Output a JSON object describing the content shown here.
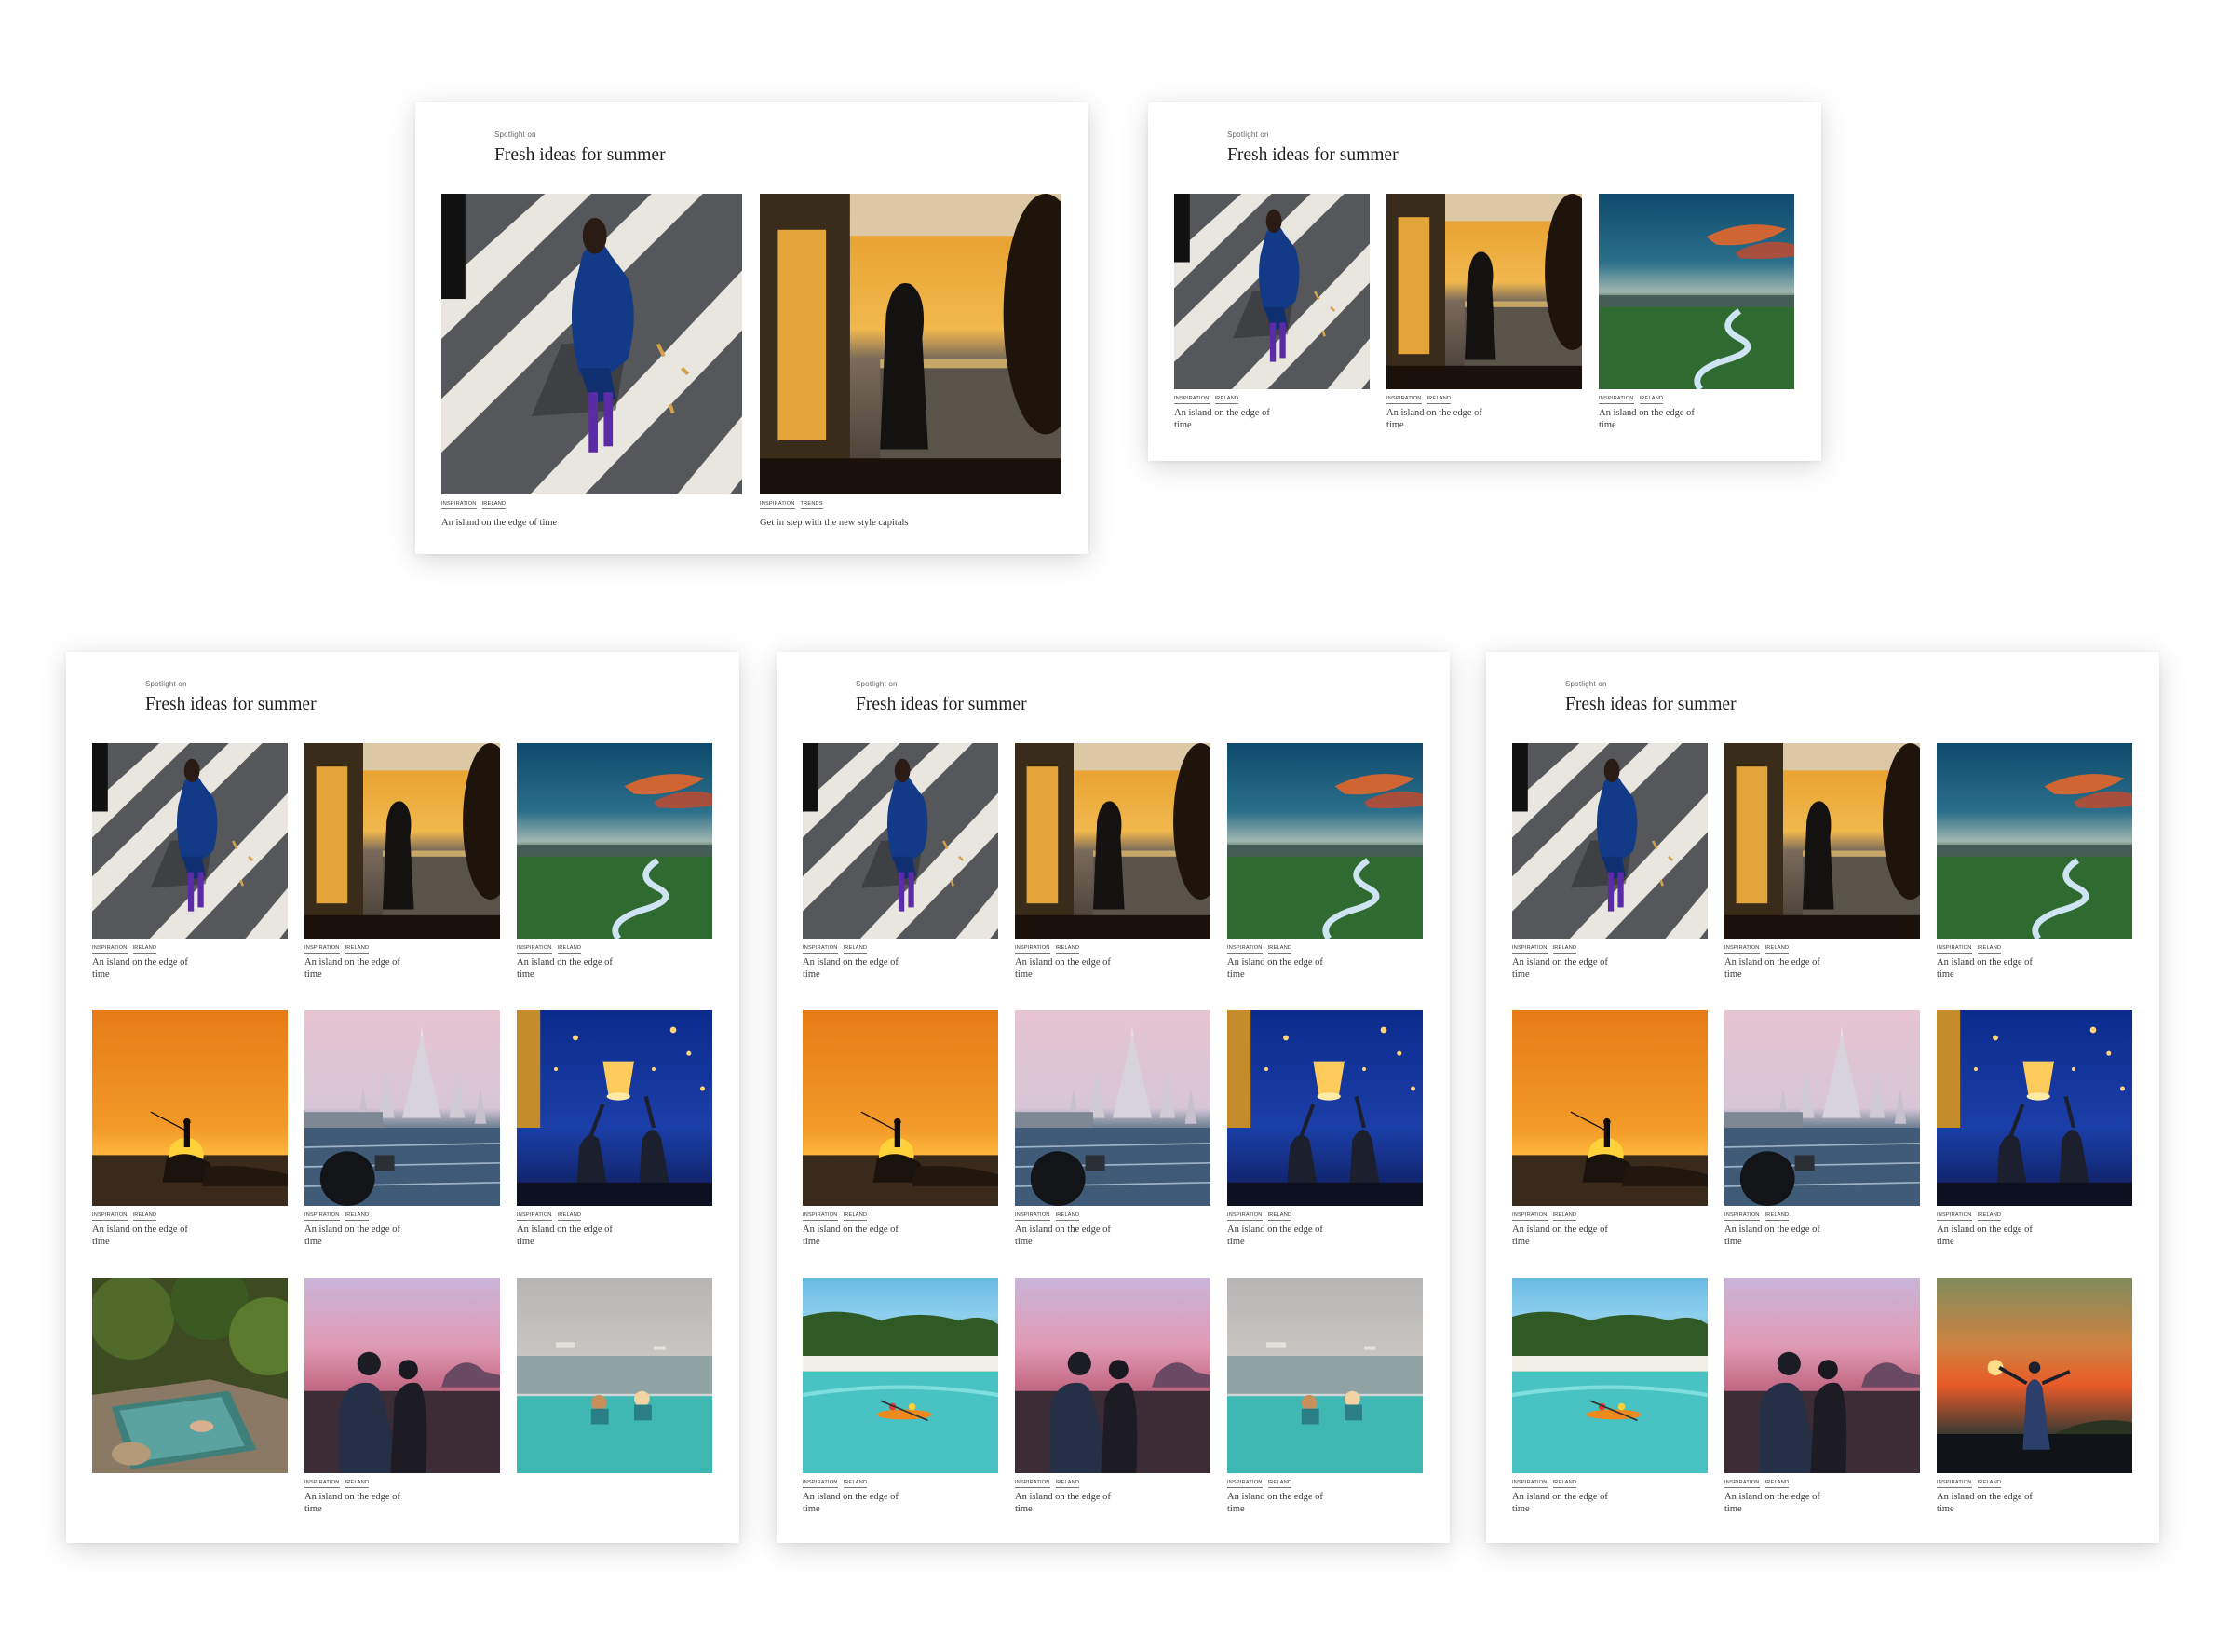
{
  "section": {
    "kicker": "Spotlight on",
    "title": "Fresh ideas for summer"
  },
  "boards": [
    {
      "cols": 2,
      "items": [
        {
          "image": "woman-crosswalk",
          "tags": [
            "INSPIRATION",
            "IRELAND"
          ],
          "caption": "An island on the edge of time"
        },
        {
          "image": "ferry-sunset",
          "tags": [
            "INSPIRATION",
            "TRENDS"
          ],
          "caption": "Get in step with the new style capitals"
        }
      ]
    },
    {
      "cols": 3,
      "items": [
        {
          "image": "woman-crosswalk",
          "tags": [
            "INSPIRATION",
            "IRELAND"
          ],
          "caption": "An island on the edge of time"
        },
        {
          "image": "ferry-sunset",
          "tags": [
            "INSPIRATION",
            "IRELAND"
          ],
          "caption": "An island on the edge of time"
        },
        {
          "image": "river-valley-sunset",
          "tags": [
            "INSPIRATION",
            "IRELAND"
          ],
          "caption": "An island on the edge of time"
        }
      ]
    },
    {
      "cols": 3,
      "items": [
        {
          "image": "woman-crosswalk",
          "tags": [
            "INSPIRATION",
            "IRELAND"
          ],
          "caption": "An island on the edge of time"
        },
        {
          "image": "ferry-sunset",
          "tags": [
            "INSPIRATION",
            "IRELAND"
          ],
          "caption": "An island on the edge of time"
        },
        {
          "image": "river-valley-sunset",
          "tags": [
            "INSPIRATION",
            "IRELAND"
          ],
          "caption": "An island on the edge of time"
        },
        {
          "image": "fisherman-sunset",
          "tags": [
            "INSPIRATION",
            "IRELAND"
          ],
          "caption": "An island on the edge of time"
        },
        {
          "image": "temple-river",
          "tags": [
            "INSPIRATION",
            "IRELAND"
          ],
          "caption": "An island on the edge of time"
        },
        {
          "image": "sky-lanterns",
          "tags": [
            "INSPIRATION",
            "IRELAND"
          ],
          "caption": "An island on the edge of time"
        },
        {
          "image": "jungle-pool",
          "tags": [],
          "caption": ""
        },
        {
          "image": "couple-beach-dusk",
          "tags": [
            "INSPIRATION",
            "IRELAND"
          ],
          "caption": "An island on the edge of time"
        },
        {
          "image": "infinity-pool",
          "tags": [],
          "caption": ""
        }
      ]
    },
    {
      "cols": 3,
      "items": [
        {
          "image": "woman-crosswalk",
          "tags": [
            "INSPIRATION",
            "IRELAND"
          ],
          "caption": "An island on the edge of time"
        },
        {
          "image": "ferry-sunset",
          "tags": [
            "INSPIRATION",
            "IRELAND"
          ],
          "caption": "An island on the edge of time"
        },
        {
          "image": "river-valley-sunset",
          "tags": [
            "INSPIRATION",
            "IRELAND"
          ],
          "caption": "An island on the edge of time"
        },
        {
          "image": "fisherman-sunset",
          "tags": [
            "INSPIRATION",
            "IRELAND"
          ],
          "caption": "An island on the edge of time"
        },
        {
          "image": "temple-river",
          "tags": [
            "INSPIRATION",
            "IRELAND"
          ],
          "caption": "An island on the edge of time"
        },
        {
          "image": "sky-lanterns",
          "tags": [
            "INSPIRATION",
            "IRELAND"
          ],
          "caption": "An island on the edge of time"
        },
        {
          "image": "kayak-beach",
          "tags": [
            "INSPIRATION",
            "IRELAND"
          ],
          "caption": "An island on the edge of time"
        },
        {
          "image": "couple-beach-dusk",
          "tags": [
            "INSPIRATION",
            "IRELAND"
          ],
          "caption": "An island on the edge of time"
        },
        {
          "image": "infinity-pool",
          "tags": [
            "INSPIRATION",
            "IRELAND"
          ],
          "caption": "An island on the edge of time"
        }
      ]
    },
    {
      "cols": 3,
      "items": [
        {
          "image": "woman-crosswalk",
          "tags": [
            "INSPIRATION",
            "IRELAND"
          ],
          "caption": "An island on the edge of time"
        },
        {
          "image": "ferry-sunset",
          "tags": [
            "INSPIRATION",
            "IRELAND"
          ],
          "caption": "An island on the edge of time"
        },
        {
          "image": "river-valley-sunset",
          "tags": [
            "INSPIRATION",
            "IRELAND"
          ],
          "caption": "An island on the edge of time"
        },
        {
          "image": "fisherman-sunset",
          "tags": [
            "INSPIRATION",
            "IRELAND"
          ],
          "caption": "An island on the edge of time"
        },
        {
          "image": "temple-river",
          "tags": [
            "INSPIRATION",
            "IRELAND"
          ],
          "caption": "An island on the edge of time"
        },
        {
          "image": "sky-lanterns",
          "tags": [
            "INSPIRATION",
            "IRELAND"
          ],
          "caption": "An island on the edge of time"
        },
        {
          "image": "kayak-beach",
          "tags": [
            "INSPIRATION",
            "IRELAND"
          ],
          "caption": "An island on the edge of time"
        },
        {
          "image": "couple-beach-dusk",
          "tags": [
            "INSPIRATION",
            "IRELAND"
          ],
          "caption": "An island on the edge of time"
        },
        {
          "image": "woman-cliff-sunset",
          "tags": [
            "INSPIRATION",
            "IRELAND"
          ],
          "caption": "An island on the edge of time"
        }
      ]
    }
  ]
}
